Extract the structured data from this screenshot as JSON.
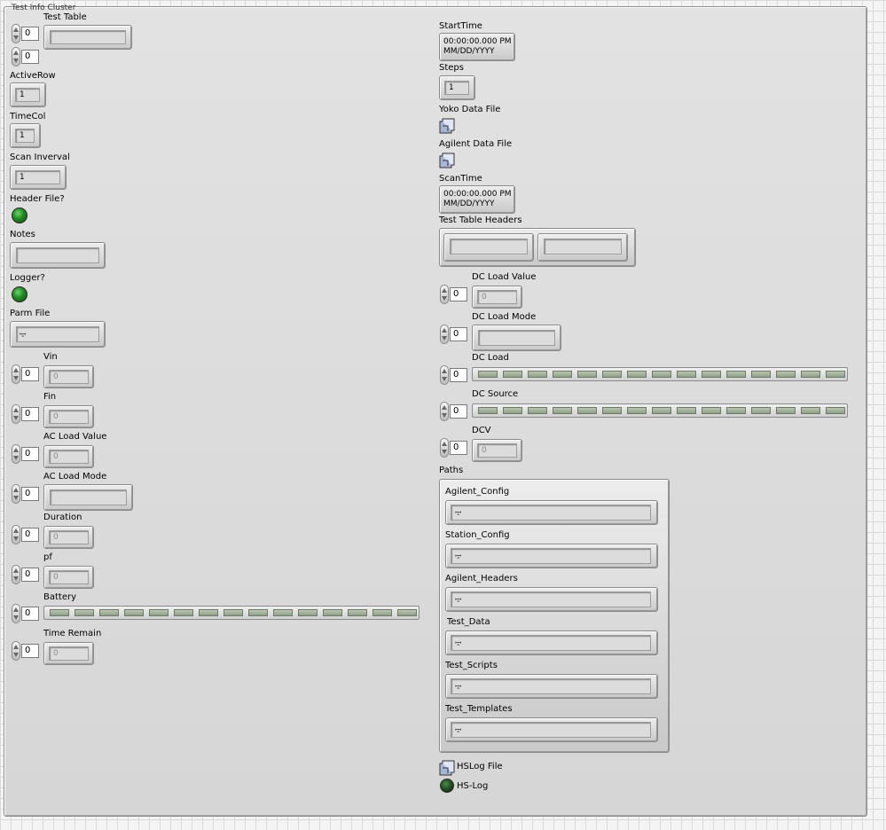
{
  "cluster": {
    "title": "Test Info Cluster"
  },
  "left": {
    "test_table": {
      "label": "Test Table",
      "row_index": "0",
      "col_index": "0"
    },
    "active_row": {
      "label": "ActiveRow",
      "value": "1"
    },
    "time_col": {
      "label": "TimeCol",
      "value": "1"
    },
    "scan_interval": {
      "label": "Scan Inverval",
      "value": "1"
    },
    "header_file": {
      "label": "Header File?"
    },
    "notes": {
      "label": "Notes",
      "value": ""
    },
    "logger": {
      "label": "Logger?"
    },
    "parm_file": {
      "label": "Parm File"
    },
    "vin": {
      "label": "Vin",
      "index": "0",
      "value": "0"
    },
    "fin": {
      "label": "Fin",
      "index": "0",
      "value": "0"
    },
    "ac_load_value": {
      "label": "AC Load Value",
      "index": "0",
      "value": "0"
    },
    "ac_load_mode": {
      "label": "AC Load Mode",
      "index": "0",
      "value": ""
    },
    "duration": {
      "label": "Duration",
      "index": "0",
      "value": "0"
    },
    "pf": {
      "label": "pf",
      "index": "0",
      "value": "0"
    },
    "battery": {
      "label": "Battery",
      "index": "0"
    },
    "time_remain": {
      "label": "Time Remain",
      "index": "0",
      "value": "0"
    }
  },
  "right": {
    "start_time": {
      "label": "StartTime",
      "time": "00:00:00.000 PM",
      "date": "MM/DD/YYYY"
    },
    "steps": {
      "label": "Steps",
      "value": "1"
    },
    "yoko_data_file": {
      "label": "Yoko Data File"
    },
    "agilent_data_file": {
      "label": "Agilent Data File"
    },
    "scan_time": {
      "label": "ScanTime",
      "time": "00:00:00.000 PM",
      "date": "MM/DD/YYYY"
    },
    "test_table_headers": {
      "label": "Test Table Headers"
    },
    "dc_load_value": {
      "label": "DC Load Value",
      "index": "0",
      "value": "0"
    },
    "dc_load_mode": {
      "label": "DC Load Mode",
      "index": "0",
      "value": ""
    },
    "dc_load": {
      "label": "DC Load",
      "index": "0"
    },
    "dc_source": {
      "label": "DC Source",
      "index": "0"
    },
    "dcv": {
      "label": "DCV",
      "index": "0",
      "value": "0"
    },
    "paths": {
      "label": "Paths",
      "items": [
        "Agilent_Config",
        "Station_Config",
        "Agilent_Headers",
        "Test_Data",
        "Test_Scripts",
        "Test_Templates"
      ]
    },
    "hslog_file": {
      "label": "HSLog File"
    },
    "hs_log": {
      "label": "HS-Log"
    }
  },
  "icons": {
    "spinner": "up-down-arrows",
    "led": "green-round-led",
    "file": "file-browse-icon",
    "path": "path-symbol"
  }
}
